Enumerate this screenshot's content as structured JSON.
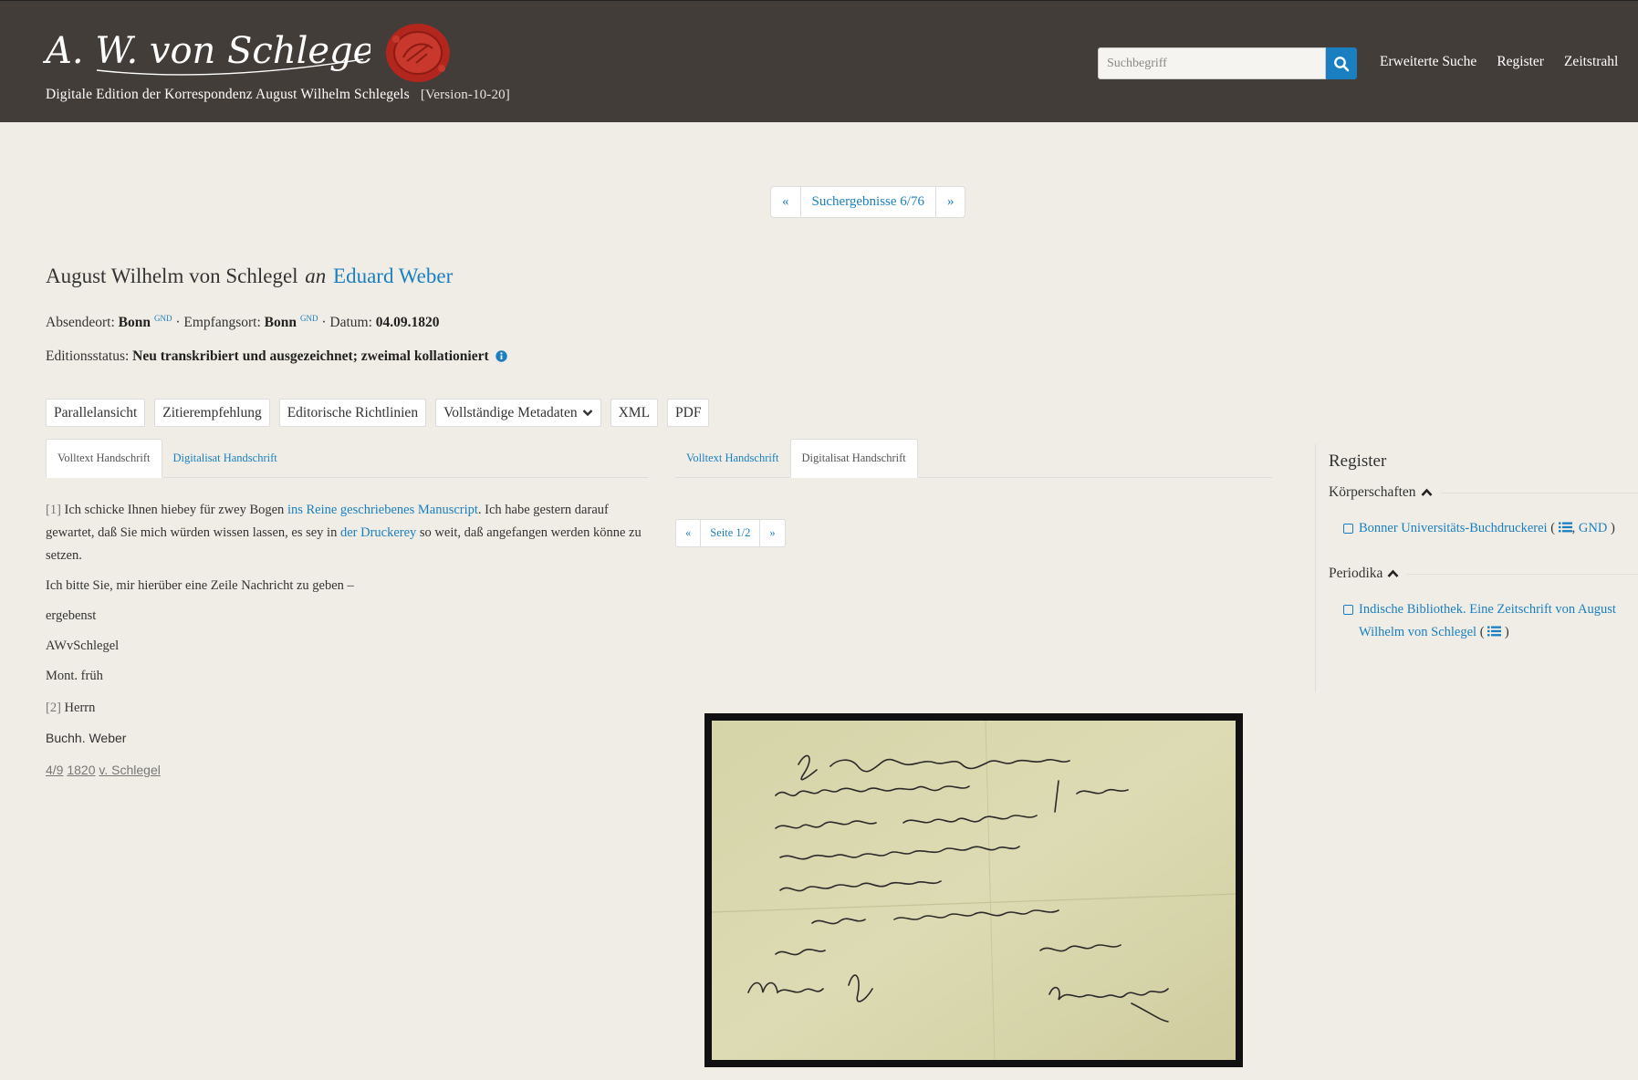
{
  "header": {
    "signature_text": "A. W. von Schlegel",
    "site_title": "Digitale Edition der Korrespondenz August Wilhelm Schlegels",
    "version": "[Version-10-20]",
    "search_placeholder": "Suchbegriff",
    "nav": [
      "Erweiterte Suche",
      "Register",
      "Zeitstrahl"
    ]
  },
  "pager": {
    "prev": "«",
    "label": "Suchergebnisse 6/76",
    "next": "»"
  },
  "letter": {
    "sender": "August Wilhelm von Schlegel",
    "connector": "an",
    "recipient": "Eduard Weber",
    "meta": {
      "sender_place_label": "Absendeort:",
      "sender_place": "Bonn",
      "recipient_place_label": "Empfangsort:",
      "recipient_place": "Bonn",
      "date_label": "Datum:",
      "date": "04.09.1820",
      "gnd": "GND",
      "separator": "·"
    },
    "status_label": "Editionsstatus:",
    "status": "Neu transkribiert und ausgezeichnet; zweimal kollationiert"
  },
  "actions": [
    "Parallelansicht",
    "Zitierempfehlung",
    "Editorische Richtlinien",
    "Vollständige Metadaten",
    "XML",
    "PDF"
  ],
  "left_tabs": [
    "Volltext Handschrift",
    "Digitalisat Handschrift"
  ],
  "right_tabs": [
    "Volltext Handschrift",
    "Digitalisat Handschrift"
  ],
  "transcript": {
    "p1_num": "[1]",
    "p1_a": "Ich schicke Ihnen hiebey für zwey Bogen",
    "p1_link1": "ins Reine geschriebenes Manuscript",
    "p1_b": ". Ich habe gestern darauf gewartet, daß Sie mich würden wissen lassen, es sey in",
    "p1_link2": "der Druckerey",
    "p1_c": "so weit, daß angefangen werden könne zu setzen.",
    "p2": "Ich bitte Sie, mir hierüber eine Zeile Nachricht zu geben –",
    "p3": "ergebenst",
    "p4": "AWvSchlegel",
    "p5": "Mont. früh",
    "p6_num": "[2]",
    "p6": "Herrn",
    "p7": "Buchh. Weber",
    "foot_a": "4/9",
    "foot_b": "1820",
    "foot_c": "v. Schlegel"
  },
  "subpager": {
    "prev": "«",
    "label": "Seite 1/2",
    "next": "»"
  },
  "register": {
    "title": "Register",
    "groups": [
      {
        "name": "Körperschaften",
        "items": [
          {
            "text": "Bonner Universitäts-Buchdruckerei",
            "open": "(",
            "gnd": "GND",
            "close": ")"
          }
        ]
      },
      {
        "name": "Periodika",
        "items": [
          {
            "text": "Indische Bibliothek. Eine Zeitschrift von August Wilhelm von Schlegel",
            "open": "(",
            "close": ")"
          }
        ]
      }
    ]
  },
  "colors": {
    "header_bg": "#433d3a",
    "link": "#1a7fc1",
    "page_bg": "#efede6",
    "seal": "#b3261e"
  }
}
